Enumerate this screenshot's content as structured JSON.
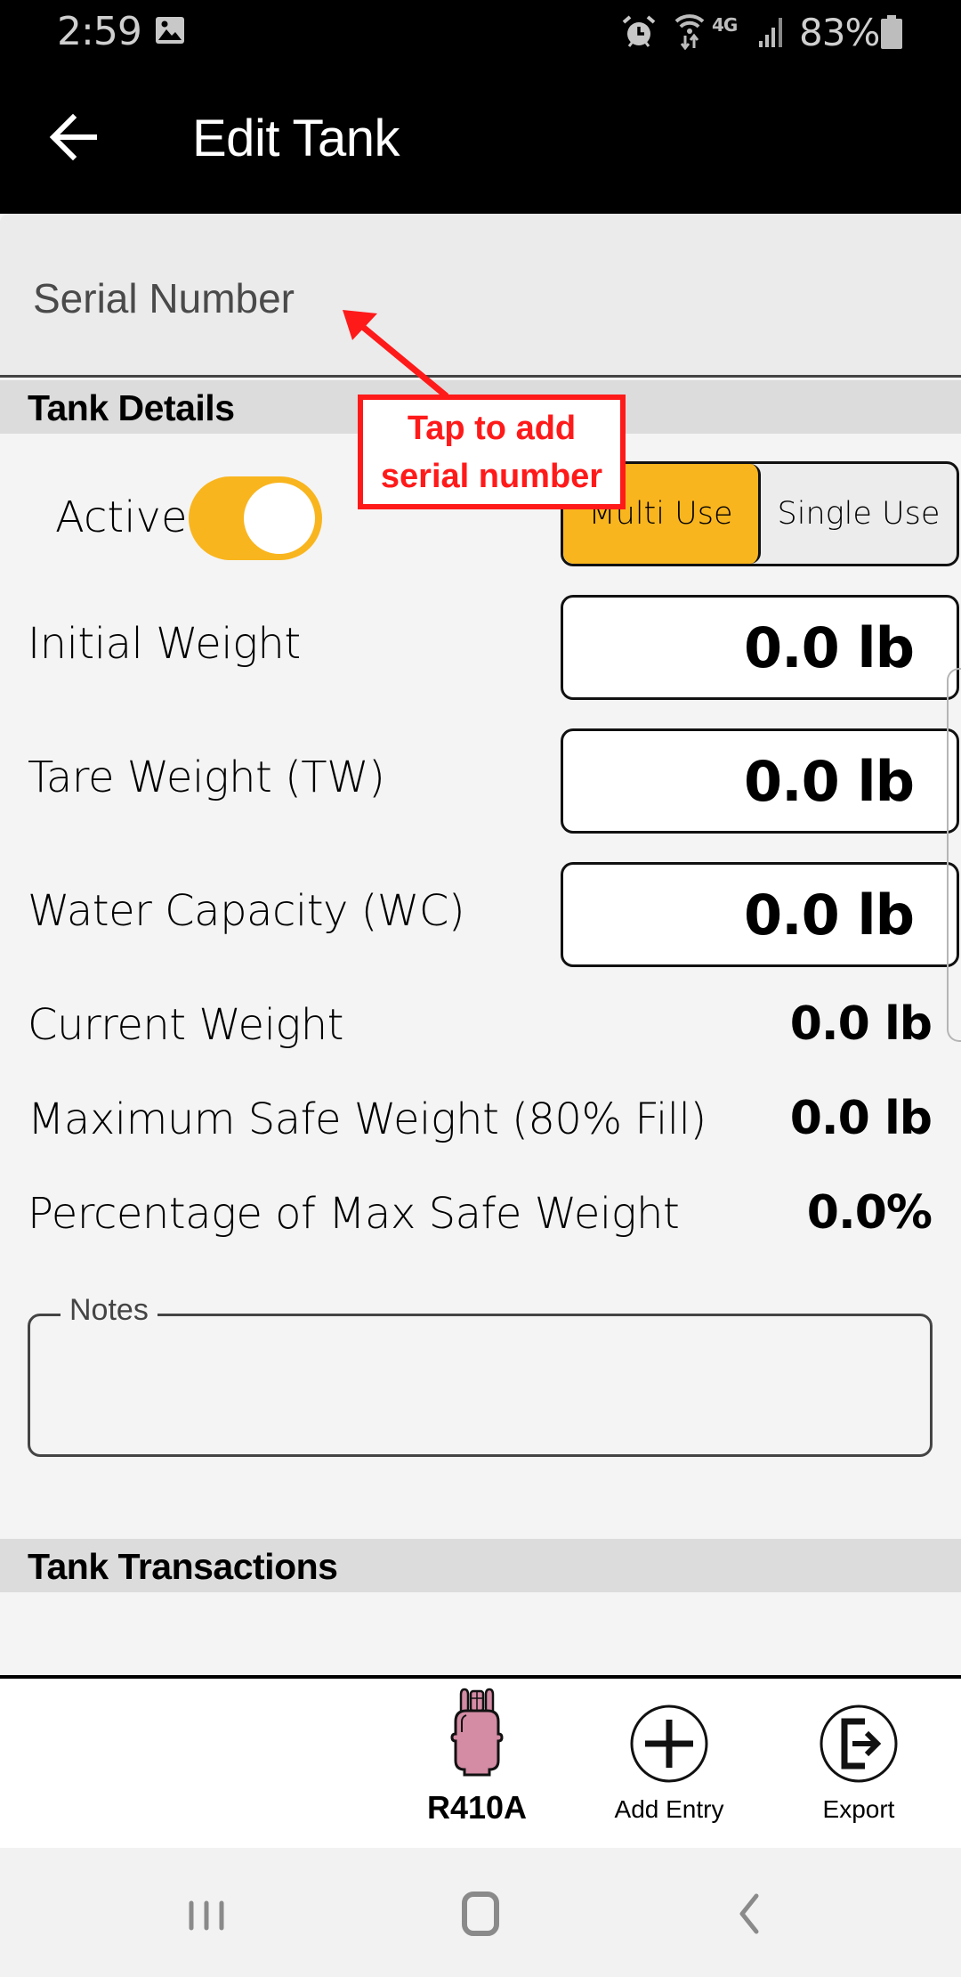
{
  "status_bar": {
    "time": "2:59",
    "network": "4G",
    "battery_percent": "83%",
    "icons": [
      "gallery-icon",
      "alarm-icon",
      "wifi-data-icon",
      "lte-icon",
      "signal-icon",
      "battery-icon"
    ]
  },
  "app_bar": {
    "title": "Edit Tank",
    "back_icon": "arrow-left-icon"
  },
  "serial": {
    "placeholder": "Serial Number",
    "value": ""
  },
  "tank_details": {
    "header": "Tank Details",
    "active_label": "Active",
    "active": true,
    "use_type_options": [
      "Multi Use",
      "Single Use"
    ],
    "use_type_selected": "Multi Use",
    "inputs": [
      {
        "label": "Initial Weight",
        "value": "0.0 lb"
      },
      {
        "label": "Tare Weight (TW)",
        "value": "0.0 lb"
      },
      {
        "label": "Water Capacity (WC)",
        "value": "0.0 lb"
      }
    ],
    "readouts": [
      {
        "label": "Current Weight",
        "value": "0.0 lb"
      },
      {
        "label": "Maximum Safe Weight (80% Fill)",
        "value": "0.0 lb"
      },
      {
        "label": "Percentage of Max Safe Weight",
        "value": "0.0%"
      }
    ],
    "notes_label": "Notes",
    "notes_value": ""
  },
  "tank_transactions": {
    "header": "Tank Transactions",
    "items": []
  },
  "footer": {
    "refrigerant_label": "R410A",
    "refrigerant_color": "#d48ba4",
    "add_entry_label": "Add Entry",
    "export_label": "Export"
  },
  "annotation": {
    "line1": "Tap to add",
    "line2": "serial number",
    "color": "#ff1a1a"
  },
  "colors": {
    "accent": "#f9b51e",
    "app_bar": "#000000",
    "background": "#f4f4f4",
    "section_header": "#dcdcdc"
  },
  "nav_bar": {
    "buttons": [
      "recents",
      "home",
      "back"
    ]
  }
}
